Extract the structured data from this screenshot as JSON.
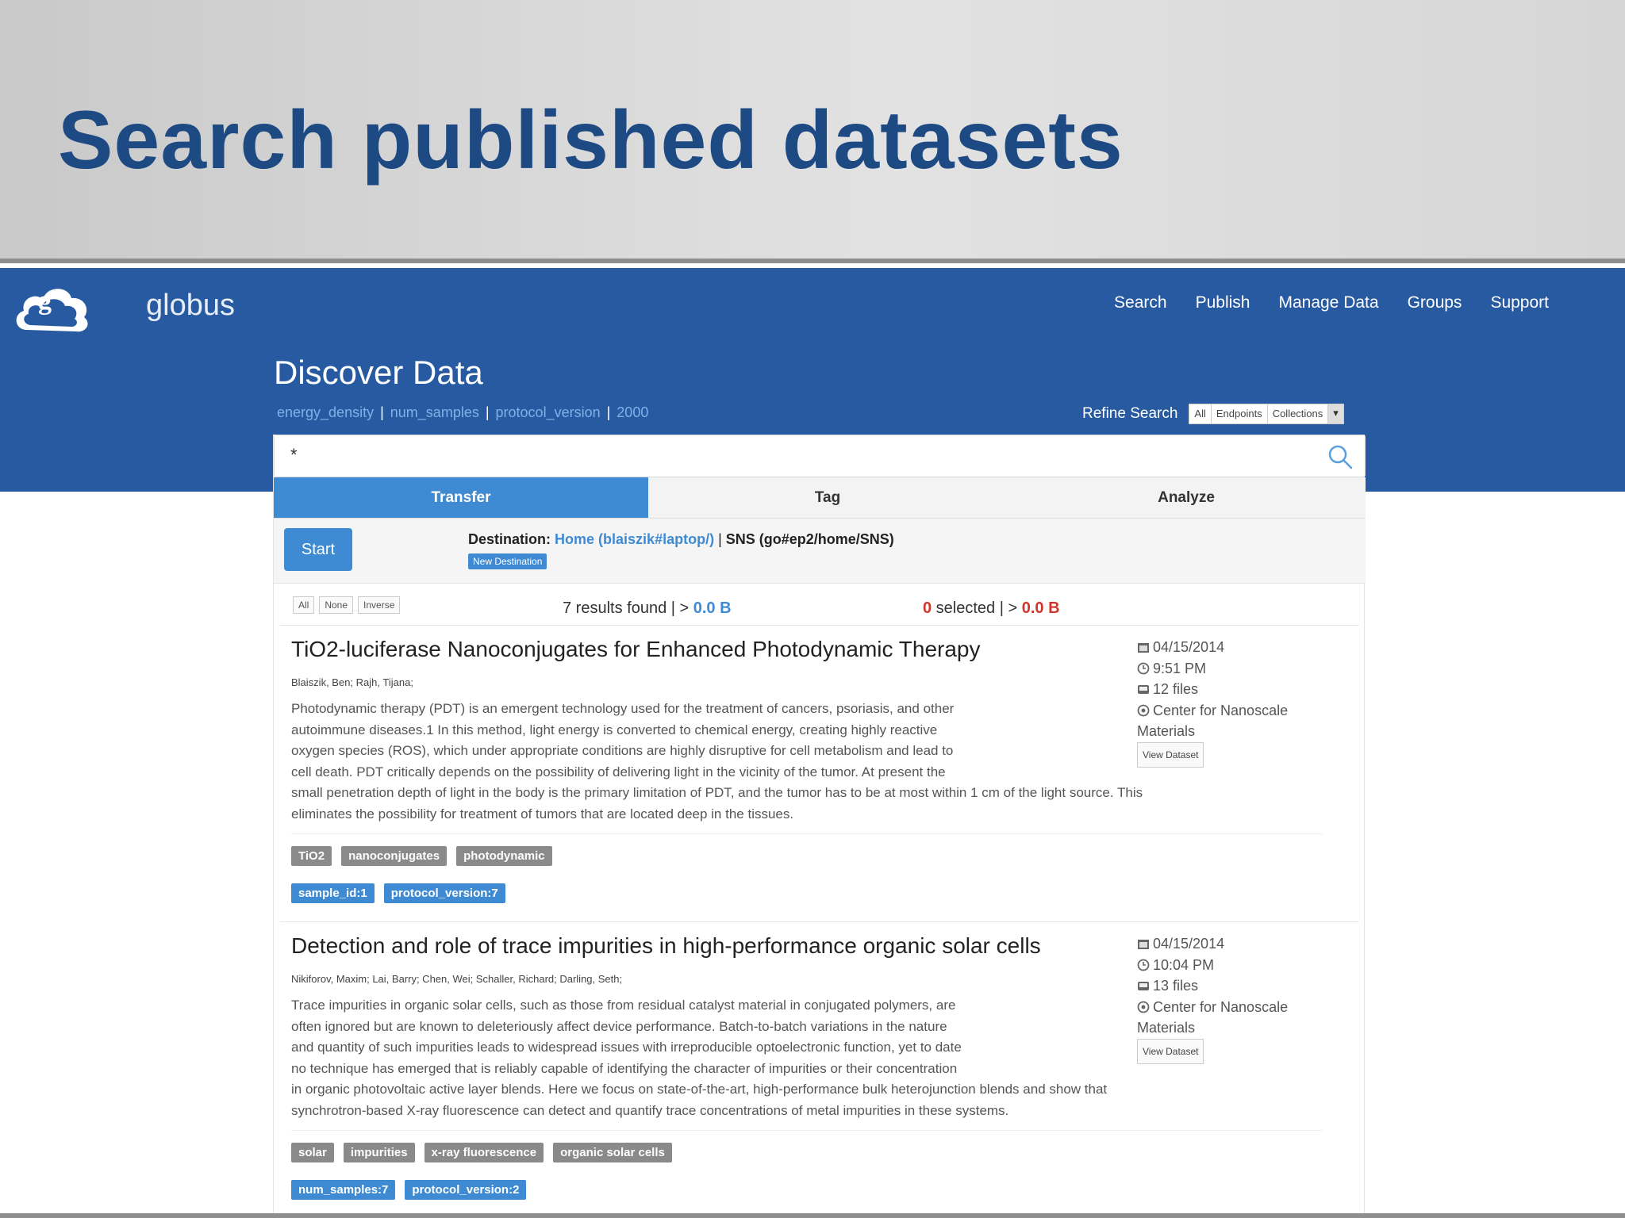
{
  "slide": {
    "title": "Search published datasets"
  },
  "brand": {
    "name": "globus"
  },
  "nav": {
    "items": [
      "Search",
      "Publish",
      "Manage Data",
      "Groups",
      "Support"
    ]
  },
  "page": {
    "title": "Discover Data"
  },
  "facets": [
    "energy_density",
    "num_samples",
    "protocol_version",
    "2000"
  ],
  "refine": {
    "label": "Refine Search",
    "options": [
      "All",
      "Endpoints",
      "Collections"
    ]
  },
  "search": {
    "value": "*"
  },
  "tabs": [
    "Transfer",
    "Tag",
    "Analyze"
  ],
  "transfer": {
    "start_label": "Start",
    "destination_label": "Destination:",
    "destination_home": "Home (blaiszik#laptop/)",
    "destination_sep": " | ",
    "destination_sns": "SNS (go#ep2/home/SNS)",
    "new_destination_label": "New Destination"
  },
  "selection": {
    "all": "All",
    "none": "None",
    "inverse": "Inverse"
  },
  "results_summary": {
    "found_text": "7 results found | >",
    "found_size": "0.0 B",
    "selected_count": "0",
    "selected_text": " selected | >",
    "selected_size": "0.0 B"
  },
  "results": [
    {
      "title": "TiO2-luciferase Nanoconjugates for Enhanced Photodynamic Therapy",
      "authors": "Blaiszik, Ben; Rajh, Tijana;",
      "abstract_lines": [
        "Photodynamic therapy (PDT) is an emergent technology used for the treatment of cancers, psoriasis, and other",
        "autoimmune diseases.1 In this method, light energy is converted to chemical energy, creating highly reactive",
        "oxygen species (ROS), which under appropriate conditions are highly disruptive for cell metabolism and lead to",
        "cell death. PDT critically depends on the possibility of delivering light in the vicinity of the tumor. At present the",
        "small penetration depth of light in the body is the primary limitation of PDT, and the tumor has to be at most within 1 cm of the light source. This",
        "eliminates the possibility for treatment of tumors that are located deep in the tissues."
      ],
      "date": "04/15/2014",
      "time": "9:51 PM",
      "files": "12 files",
      "org_line1": "Center for Nanoscale",
      "org_line2": "Materials",
      "view_label": "View Dataset",
      "tags": [
        "TiO2",
        "nanoconjugates",
        "photodynamic"
      ],
      "kv_tags": [
        "sample_id:1",
        "protocol_version:7"
      ]
    },
    {
      "title": "Detection and role of trace impurities in high-performance organic solar cells",
      "authors": "Nikiforov, Maxim;  Lai, Barry;  Chen, Wei;  Schaller, Richard;  Darling, Seth;",
      "abstract_lines": [
        "Trace impurities in organic solar cells, such as those from residual catalyst material in conjugated polymers, are",
        "often ignored but are known to deleteriously affect device performance. Batch-to-batch variations in the nature",
        "and quantity of such impurities leads to widespread issues with irreproducible optoelectronic function, yet to date",
        "no technique has emerged that is reliably capable of identifying the character of impurities or their concentration",
        "in organic photovoltaic active layer blends. Here we focus on state-of-the-art, high-performance bulk heterojunction blends and show that",
        "synchrotron-based X-ray fluorescence can detect and quantify trace concentrations of metal impurities in these systems."
      ],
      "date": "04/15/2014",
      "time": "10:04 PM",
      "files": "13 files",
      "org_line1": "Center for Nanoscale",
      "org_line2": "Materials",
      "view_label": "View Dataset",
      "tags": [
        "solar",
        "impurities",
        "x-ray fluorescence",
        "organic solar cells"
      ],
      "kv_tags": [
        "num_samples:7",
        "protocol_version:2"
      ]
    }
  ],
  "colors": {
    "slide_title": "#1e4a84",
    "band": "#275aa0",
    "accent": "#3f8bd3",
    "danger": "#d0342c"
  },
  "icons": {
    "logo": "globus-cloud-logo",
    "search": "search-icon",
    "calendar": "calendar-icon",
    "clock": "clock-icon",
    "files": "files-icon",
    "org": "organization-icon"
  }
}
